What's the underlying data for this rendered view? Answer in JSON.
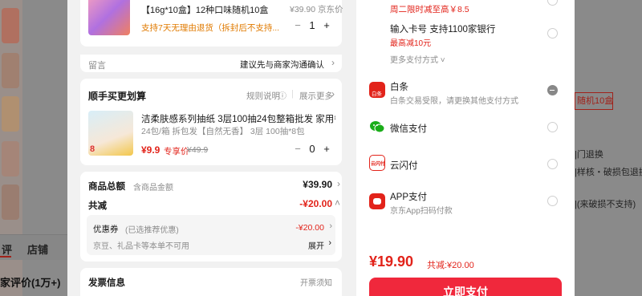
{
  "background": {
    "tabs": [
      "评",
      "店铺"
    ],
    "reviews_heading": "家评价(1万+)",
    "right_texts": [
      "|门退换",
      "|样核・破损包退换",
      "|(来破损不支持)"
    ],
    "right_box": "随机10盒"
  },
  "product": {
    "name_prefix": "【16g*10盒】",
    "name": "12种口味随机10盒",
    "price_info": "¥39.90 京东价",
    "return_note": "支持7天无理由退货（拆封后不支持...",
    "qty": "1"
  },
  "remark": {
    "label": "留言",
    "hint": "建议先与商家沟通确认"
  },
  "addon": {
    "title": "顺手买更划算",
    "rules": "规则说明",
    "more": "展示更多",
    "item_name": "洁柔肤感系列抽纸 3层100抽24包整箱批发 家用餐巾...",
    "item_spec": "24包/箱 拆包发【自然无香】 3层 100抽*8包",
    "price": "¥9.9",
    "price_tag": "专享价",
    "orig_price": "¥49.9",
    "qty": "0"
  },
  "summary": {
    "total_label": "商品总额",
    "total_sub": "含商品金额",
    "total_value": "¥39.90",
    "discount_label": "共减",
    "discount_value": "-¥20.00",
    "coupon_label": "优惠券",
    "coupon_sub": "(已选推荐优惠)",
    "coupon_value": "-¥20.00",
    "points_label": "京豆、礼品卡等本单不可用",
    "expand": "展开"
  },
  "invoice": {
    "label": "发票信息",
    "note": "开票须知"
  },
  "payment": {
    "promo_top": "周二限时减至高￥8.5",
    "card_title": "输入卡号 支持1100家银行",
    "card_promo": "最高减10元",
    "more_methods": "更多支付方式",
    "methods": [
      {
        "name": "白条",
        "sub": "白条交易受限，请更换其他支付方式",
        "icon": "baitiao-icon",
        "color": "#e2231a",
        "label": "白条"
      },
      {
        "name": "微信支付",
        "sub": "",
        "icon": "wechat-pay-icon",
        "color": "#1aad19",
        "label": ""
      },
      {
        "name": "云闪付",
        "sub": "",
        "icon": "unionpay-icon",
        "color": "#e2231a",
        "label": "云闪付"
      },
      {
        "name": "APP支付",
        "sub": "京东App扫码付款",
        "icon": "app-pay-icon",
        "color": "#e2231a",
        "label": ""
      }
    ],
    "pay_amount": "¥19.90",
    "pay_discount": "共减:¥20.00",
    "pay_button": "立即支付"
  }
}
